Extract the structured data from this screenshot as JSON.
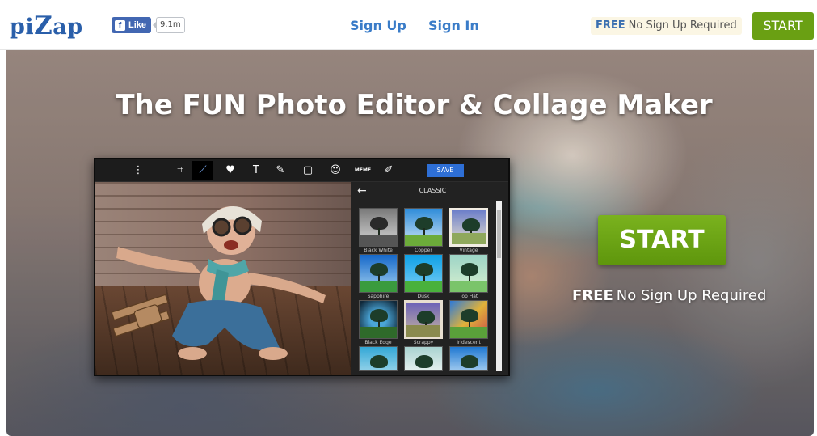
{
  "header": {
    "logo_pre": "pi",
    "logo_z": "Z",
    "logo_post": "ap",
    "fb_like": "Like",
    "fb_count": "9.1m",
    "nav": {
      "sign_up": "Sign Up",
      "sign_in": "Sign In"
    },
    "free_badge": {
      "free": "FREE",
      "text": "No Sign Up Required"
    },
    "start_label": "START"
  },
  "hero": {
    "title": "The FUN Photo Editor & Collage Maker",
    "start_label": "START",
    "free": "FREE",
    "free_text": "No Sign Up Required"
  },
  "editor": {
    "save_label": "SAVE",
    "meme_label": "MEME",
    "panel_title": "CLASSIC",
    "filters": [
      "Black White",
      "Copper",
      "Vintage",
      "Sapphire",
      "Dusk",
      "Top Hat",
      "Black Edge",
      "Scrappy",
      "Iridescent",
      "",
      "",
      ""
    ],
    "tools": [
      "more-icon",
      "crop-icon",
      "magic-wand-icon",
      "heart-icon",
      "text-icon",
      "paint-icon",
      "frame-icon",
      "sticker-icon",
      "meme-icon",
      "brush-icon"
    ]
  },
  "colors": {
    "brand_blue": "#2a5faa",
    "link_blue": "#3a7cc8",
    "start_green": "#6aa013",
    "save_blue": "#2e6fd6"
  }
}
